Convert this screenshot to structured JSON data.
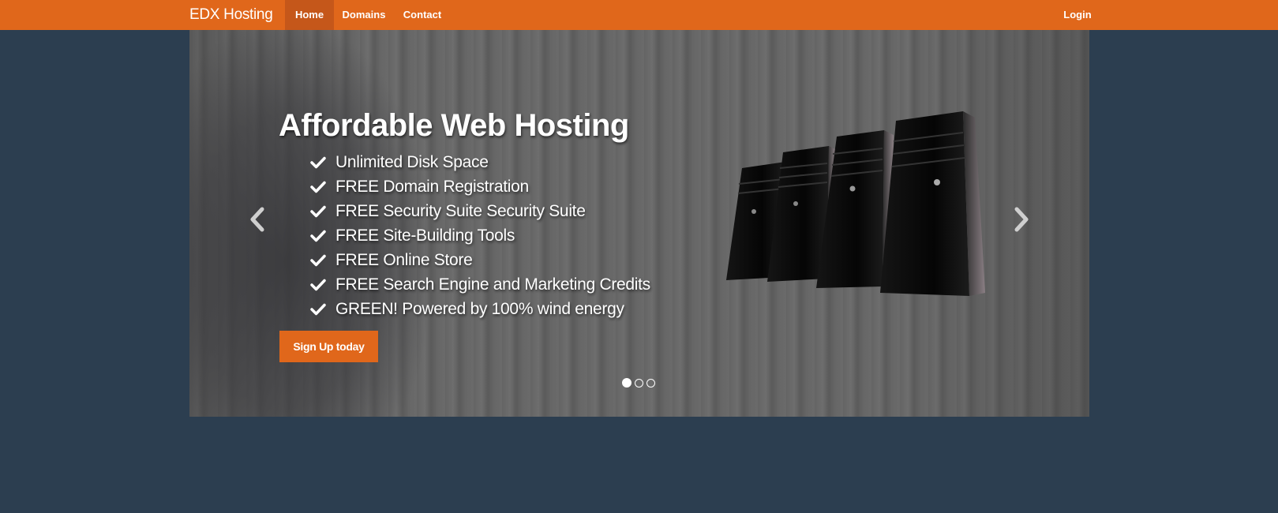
{
  "navbar": {
    "brand": "EDX Hosting",
    "links": [
      "Home",
      "Domains",
      "Contact"
    ],
    "active": "Home",
    "login": "Login",
    "color": "#e0671b"
  },
  "hero": {
    "headline": "Affordable Web Hosting",
    "features": [
      "Unlimited Disk Space",
      "FREE Domain Registration",
      "FREE Security Suite Security Suite",
      "FREE Site-Building Tools",
      "FREE Online Store",
      "FREE Search Engine and Marketing Credits",
      "GREEN! Powered by 100% wind energy"
    ],
    "cta": "Sign Up today",
    "feature_icon": "check-icon"
  },
  "carousel": {
    "slide_count": 3,
    "active_index": 0,
    "prev_icon": "chevron-left-icon",
    "next_icon": "chevron-right-icon"
  },
  "colors": {
    "background": "#2c3e50",
    "accent": "#e0671b"
  }
}
